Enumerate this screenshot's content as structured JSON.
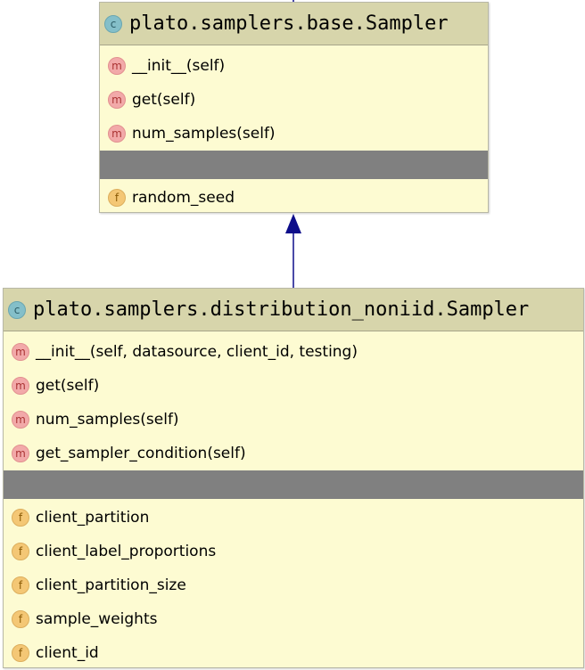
{
  "base_class": {
    "kind_badge": "c",
    "name": "plato.samplers.base.Sampler",
    "methods": [
      {
        "badge": "m",
        "label": "__init__(self)"
      },
      {
        "badge": "m",
        "label": "get(self)"
      },
      {
        "badge": "m",
        "label": "num_samples(self)"
      }
    ],
    "fields": [
      {
        "badge": "f",
        "label": "random_seed"
      }
    ]
  },
  "derived_class": {
    "kind_badge": "c",
    "name": "plato.samplers.distribution_noniid.Sampler",
    "methods": [
      {
        "badge": "m",
        "label": "__init__(self, datasource, client_id, testing)"
      },
      {
        "badge": "m",
        "label": "get(self)"
      },
      {
        "badge": "m",
        "label": "num_samples(self)"
      },
      {
        "badge": "m",
        "label": "get_sampler_condition(self)"
      }
    ],
    "fields": [
      {
        "badge": "f",
        "label": "client_partition"
      },
      {
        "badge": "f",
        "label": "client_label_proportions"
      },
      {
        "badge": "f",
        "label": "client_partition_size"
      },
      {
        "badge": "f",
        "label": "sample_weights"
      },
      {
        "badge": "f",
        "label": "client_id"
      }
    ]
  },
  "relationship": {
    "type": "inheritance",
    "arrow_color": "#0d0d8a"
  }
}
